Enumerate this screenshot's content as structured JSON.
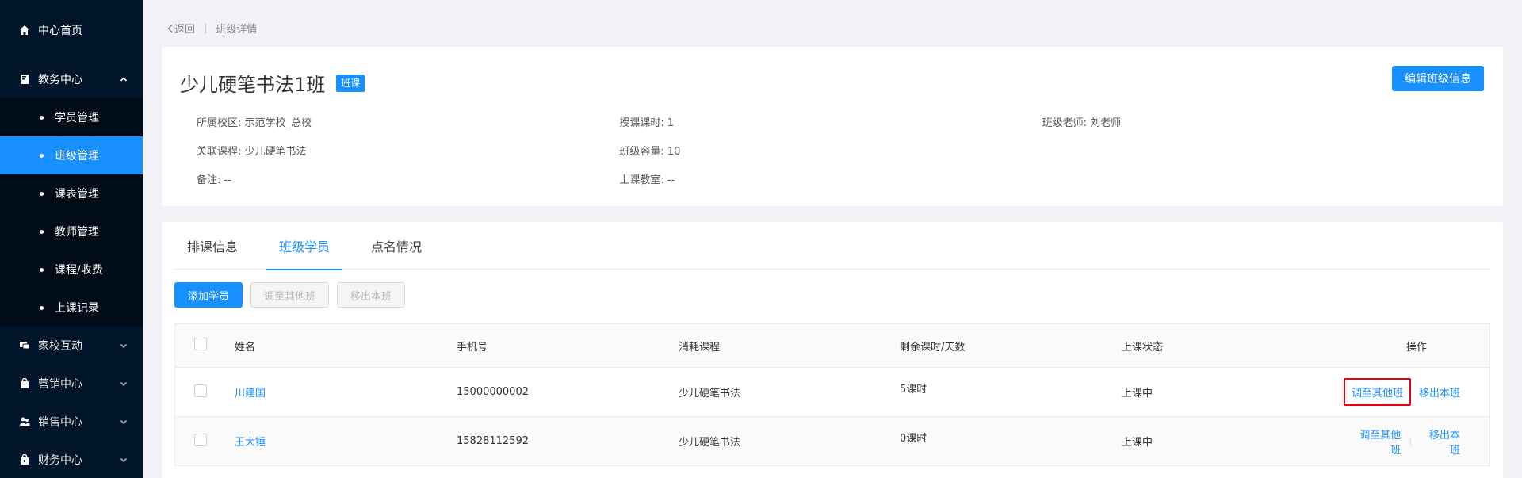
{
  "sidebar": {
    "home": "中心首页",
    "academic": {
      "label": "教务中心",
      "items": [
        "学员管理",
        "班级管理",
        "课表管理",
        "教师管理",
        "课程/收费",
        "上课记录"
      ]
    },
    "homeschool": "家校互动",
    "marketing": "营销中心",
    "sales": "销售中心",
    "finance": "财务中心"
  },
  "breadcrumb": {
    "back": "返回",
    "current": "班级详情"
  },
  "class_info": {
    "title": "少儿硬笔书法1班",
    "tag": "班课",
    "edit_label": "编辑班级信息",
    "fields": [
      [
        "所属校区: 示范学校_总校",
        "授课课时: 1",
        "班级老师:  刘老师"
      ],
      [
        "关联课程: 少儿硬笔书法",
        "班级容量: 10",
        ""
      ],
      [
        "备注: --",
        "上课教室: --",
        ""
      ]
    ]
  },
  "tabs": [
    "排课信息",
    "班级学员",
    "点名情况"
  ],
  "actions": {
    "add": "添加学员",
    "transfer": "调至其他班",
    "remove": "移出本班"
  },
  "table": {
    "headers": [
      "姓名",
      "手机号",
      "消耗课程",
      "剩余课时/天数",
      "上课状态",
      "操作"
    ],
    "rows": [
      {
        "name": "川建国",
        "phone": "15000000002",
        "course": "少儿硬笔书法",
        "remain": "5课时",
        "status": "上课中",
        "op1": "调至其他班",
        "op2": "移出本班"
      },
      {
        "name": "王大锤",
        "phone": "15828112592",
        "course": "少儿硬笔书法",
        "remain": "0课时",
        "status": "上课中",
        "op1": "调至其他班",
        "op2": "移出本班"
      }
    ]
  },
  "colors": {
    "accent": "#1890ff",
    "sidebar_bg": "#001529",
    "highlight_border": "#e60012"
  }
}
